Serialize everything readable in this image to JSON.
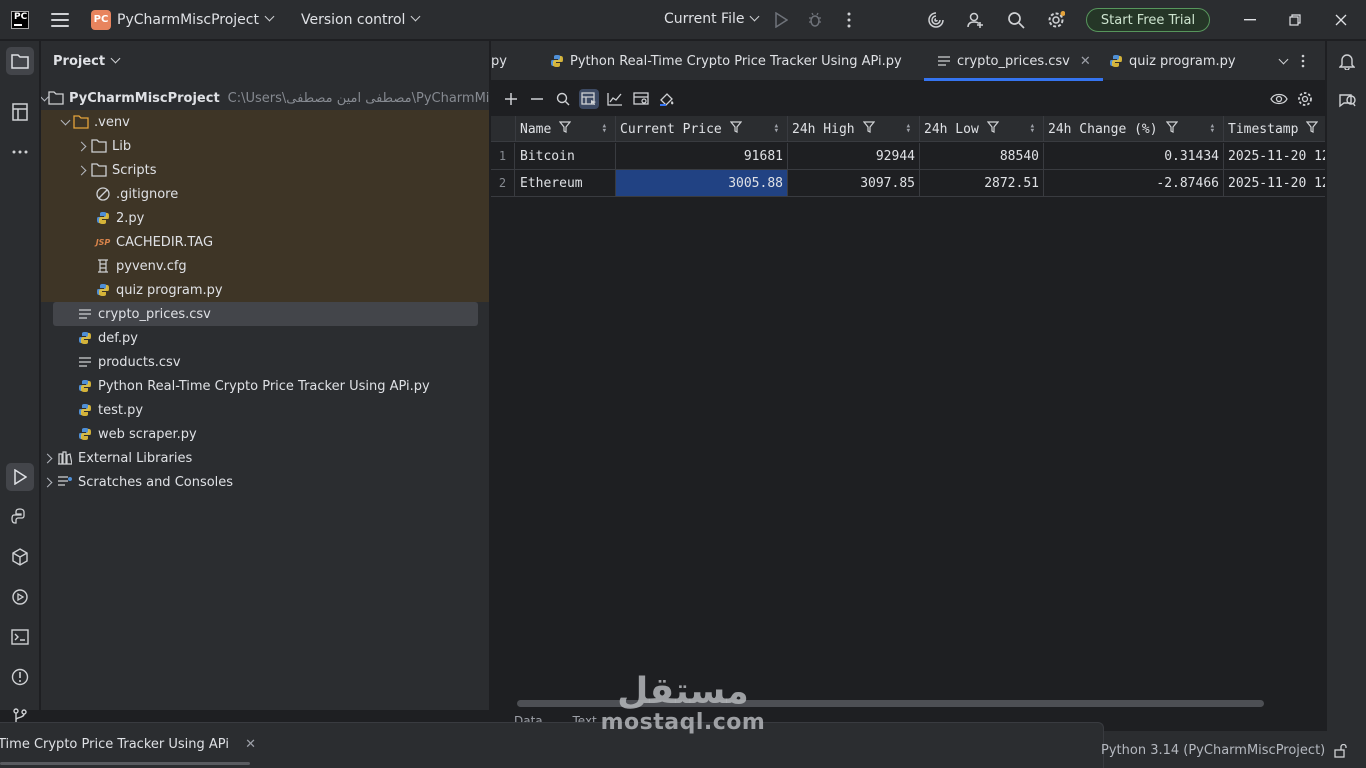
{
  "titlebar": {
    "logo_text": "PC",
    "project_badge": "PC",
    "project_name": "PyCharmMiscProject",
    "version_control": "Version control",
    "run_config": "Current File",
    "trial_label": "Start Free Trial"
  },
  "project_panel": {
    "title": "Project",
    "root_name": "PyCharmMiscProject",
    "root_path": "C:\\Users\\مصطفى امين مصطفى\\PyCharmMiscProj",
    "items": [
      {
        "label": ".venv",
        "icon": "folder-icon"
      },
      {
        "label": "Lib",
        "icon": "folder-icon"
      },
      {
        "label": "Scripts",
        "icon": "folder-icon"
      },
      {
        "label": ".gitignore",
        "icon": "ignore-icon"
      },
      {
        "label": "2.py",
        "icon": "python-icon"
      },
      {
        "label": "CACHEDIR.TAG",
        "icon": "jsp-icon"
      },
      {
        "label": "pyvenv.cfg",
        "icon": "config-icon"
      },
      {
        "label": "quiz program.py",
        "icon": "python-icon"
      },
      {
        "label": "crypto_prices.csv",
        "icon": "text-file-icon"
      },
      {
        "label": "def.py",
        "icon": "python-icon"
      },
      {
        "label": "products.csv",
        "icon": "text-file-icon"
      },
      {
        "label": "Python Real-Time Crypto Price Tracker Using APi.py",
        "icon": "python-icon"
      },
      {
        "label": "test.py",
        "icon": "python-icon"
      },
      {
        "label": "web scraper.py",
        "icon": "python-icon"
      },
      {
        "label": "External Libraries",
        "icon": "library-icon"
      },
      {
        "label": "Scratches and Consoles",
        "icon": "scratches-icon"
      }
    ],
    "jsp_badge": "JSP"
  },
  "tabs": [
    {
      "label": "py"
    },
    {
      "label": "Python Real-Time Crypto Price Tracker Using APi.py"
    },
    {
      "label": "crypto_prices.csv"
    },
    {
      "label": "quiz program.py"
    }
  ],
  "grid": {
    "columns": [
      "Name",
      "Current Price",
      "24h High",
      "24h Low",
      "24h Change (%)",
      "Timestamp"
    ],
    "rows": [
      {
        "num": "1",
        "cells": [
          "Bitcoin",
          "91681",
          "92944",
          "88540",
          "0.31434",
          "2025-11-20 12"
        ]
      },
      {
        "num": "2",
        "cells": [
          "Ethereum",
          "3005.88",
          "3097.85",
          "2872.51",
          "-2.87466",
          "2025-11-20 12"
        ]
      }
    ],
    "selected_cell": "Ethereum / Current Price"
  },
  "bottom": {
    "view_tab_data": "Data",
    "view_tab_text": "Text",
    "run_tab": "Time Crypto Price Tracker Using APi",
    "interpreter": "Python 3.14 (PyCharmMiscProject)"
  },
  "watermark": {
    "arabic": "مستقل",
    "latin": "mostaql.com"
  },
  "colors": {
    "accent": "#3574f0",
    "trial_border": "#57965c",
    "venv_highlight": "#3e3526",
    "selection": "#214283"
  }
}
